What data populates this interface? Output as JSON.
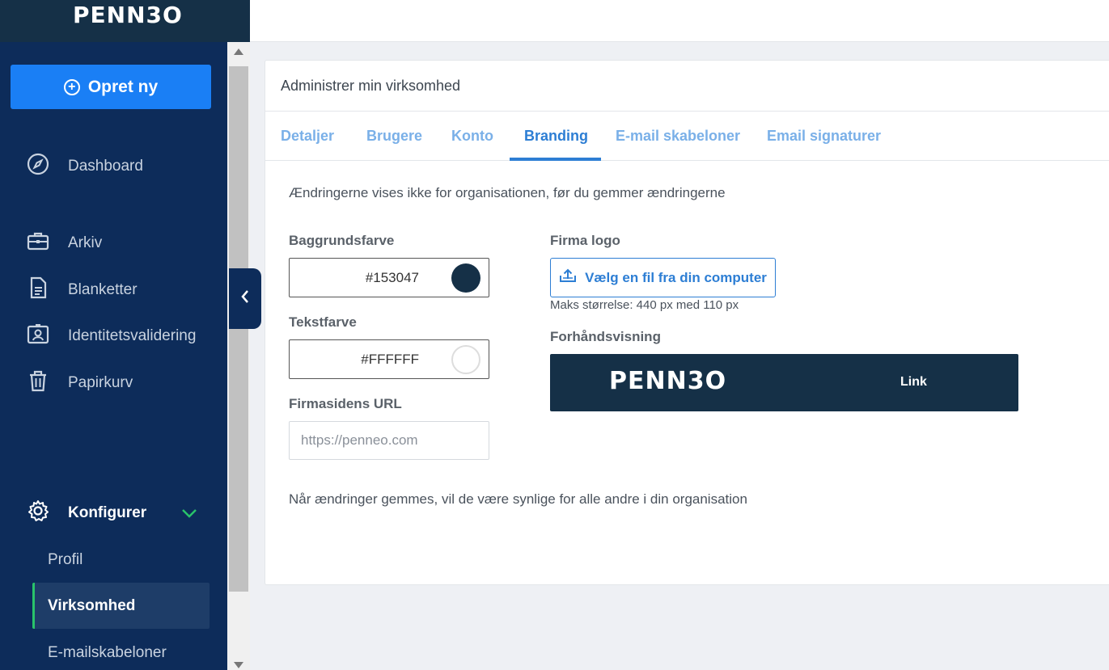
{
  "app": {
    "logo": "PENN3O"
  },
  "sidebar": {
    "create_label": "Opret ny",
    "items": [
      {
        "label": "Dashboard",
        "icon": "compass-icon"
      },
      {
        "label": "Arkiv",
        "icon": "briefcase-icon"
      },
      {
        "label": "Blanketter",
        "icon": "document-icon"
      },
      {
        "label": "Identitetsvalidering",
        "icon": "id-card-icon"
      },
      {
        "label": "Papirkurv",
        "icon": "trash-icon"
      }
    ],
    "configure": {
      "label": "Konfigurer",
      "icon": "gear-icon",
      "expanded": true
    },
    "sub_items": [
      {
        "label": "Profil",
        "active": false
      },
      {
        "label": "Virksomhed",
        "active": true
      },
      {
        "label": "E-mailskabeloner",
        "active": false
      }
    ]
  },
  "card": {
    "title": "Administrer min virksomhed",
    "tabs": [
      {
        "label": "Detaljer",
        "active": false
      },
      {
        "label": "Brugere",
        "active": false
      },
      {
        "label": "Konto",
        "active": false
      },
      {
        "label": "Branding",
        "active": true
      },
      {
        "label": "E-mail skabeloner",
        "active": false
      },
      {
        "label": "Email signaturer",
        "active": false
      }
    ],
    "info_text": "Ændringerne vises ikke for organisationen, før du gemmer ændringerne",
    "background_color": {
      "label": "Baggrundsfarve",
      "value": "#153047"
    },
    "text_color": {
      "label": "Tekstfarve",
      "value": "#FFFFFF"
    },
    "url": {
      "label": "Firmasidens URL",
      "placeholder": "https://penneo.com"
    },
    "logo": {
      "label": "Firma logo",
      "upload_label": "Vælg en fil fra din computer",
      "max_size": "Maks størrelse: 440 px med 110 px"
    },
    "preview": {
      "label": "Forhåndsvisning",
      "logo_text": "PENN3O",
      "link_text": "Link"
    },
    "footer_note": "Når ændringer gemmes, vil de være synlige for alle andre i din organisation"
  },
  "colors": {
    "sidebar_bg": "#0d2c5a",
    "primary": "#1a7ff5",
    "active_tab": "#2d7ed4",
    "brand_dark": "#153047",
    "accent_green": "#29c36a"
  }
}
